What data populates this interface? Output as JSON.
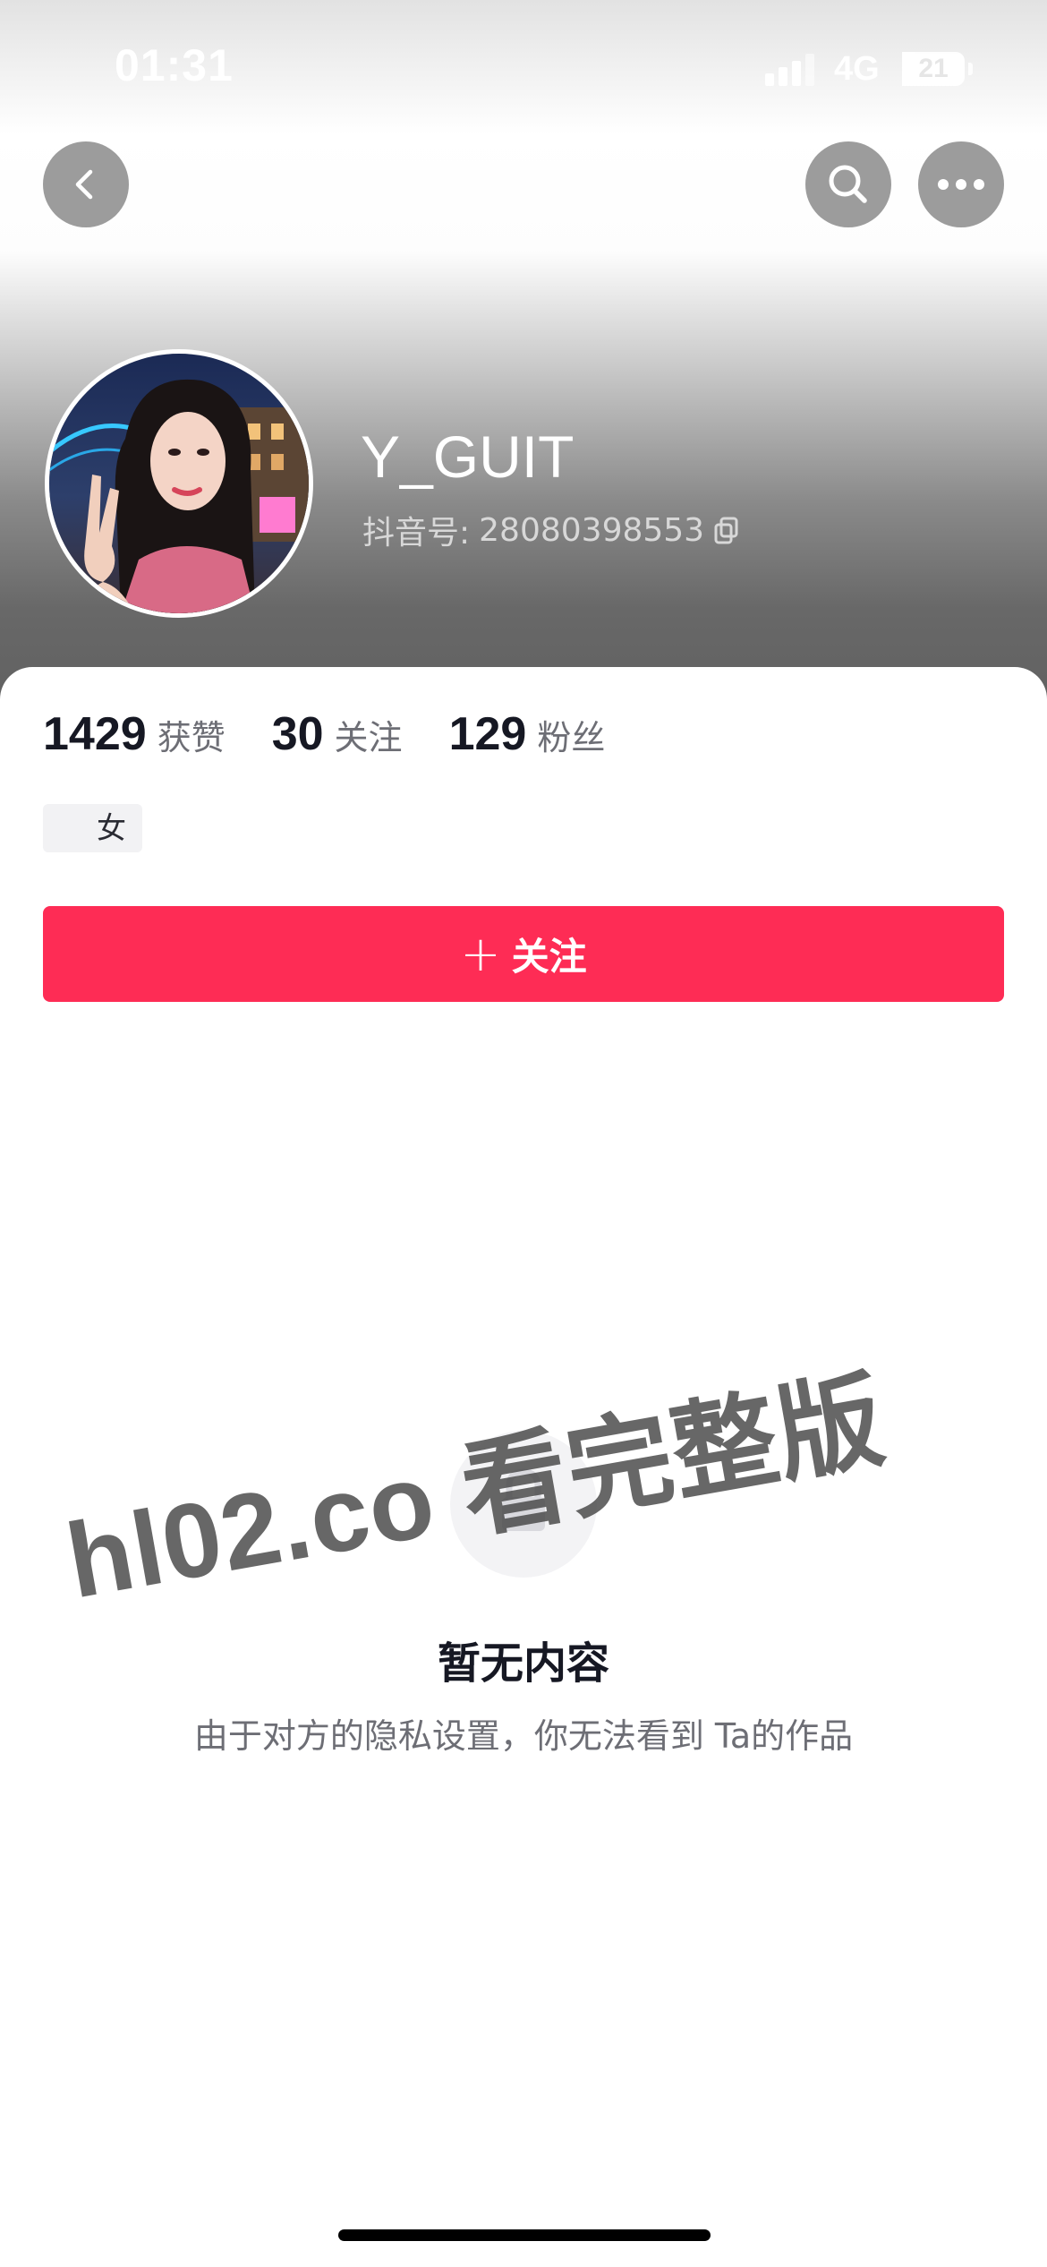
{
  "status_bar": {
    "time": "01:31",
    "network": "4G",
    "battery": "21",
    "battery_level_percent": 21
  },
  "nav": {
    "back_icon": "chevron-left-icon",
    "search_icon": "search-icon",
    "more_icon": "more-dots-icon"
  },
  "profile": {
    "username": "Y_GUIT",
    "douyin_id_label": "抖音号:",
    "douyin_id": "28080398553",
    "copy_icon": "copy-icon"
  },
  "stats": [
    {
      "value": "1429",
      "label": "获赞"
    },
    {
      "value": "30",
      "label": "关注"
    },
    {
      "value": "129",
      "label": "粉丝"
    }
  ],
  "tags": {
    "gender": "女"
  },
  "follow_button": {
    "plus": "+",
    "label": "关注"
  },
  "empty_state": {
    "icon": "lock-icon",
    "title": "暂无内容",
    "description": "由于对方的隐私设置，你无法看到 Ta的作品"
  },
  "watermark": "hl02.co 看完整版",
  "colors": {
    "accent": "#fe2c55",
    "text_primary": "#161823",
    "text_secondary": "#6d6e75"
  }
}
